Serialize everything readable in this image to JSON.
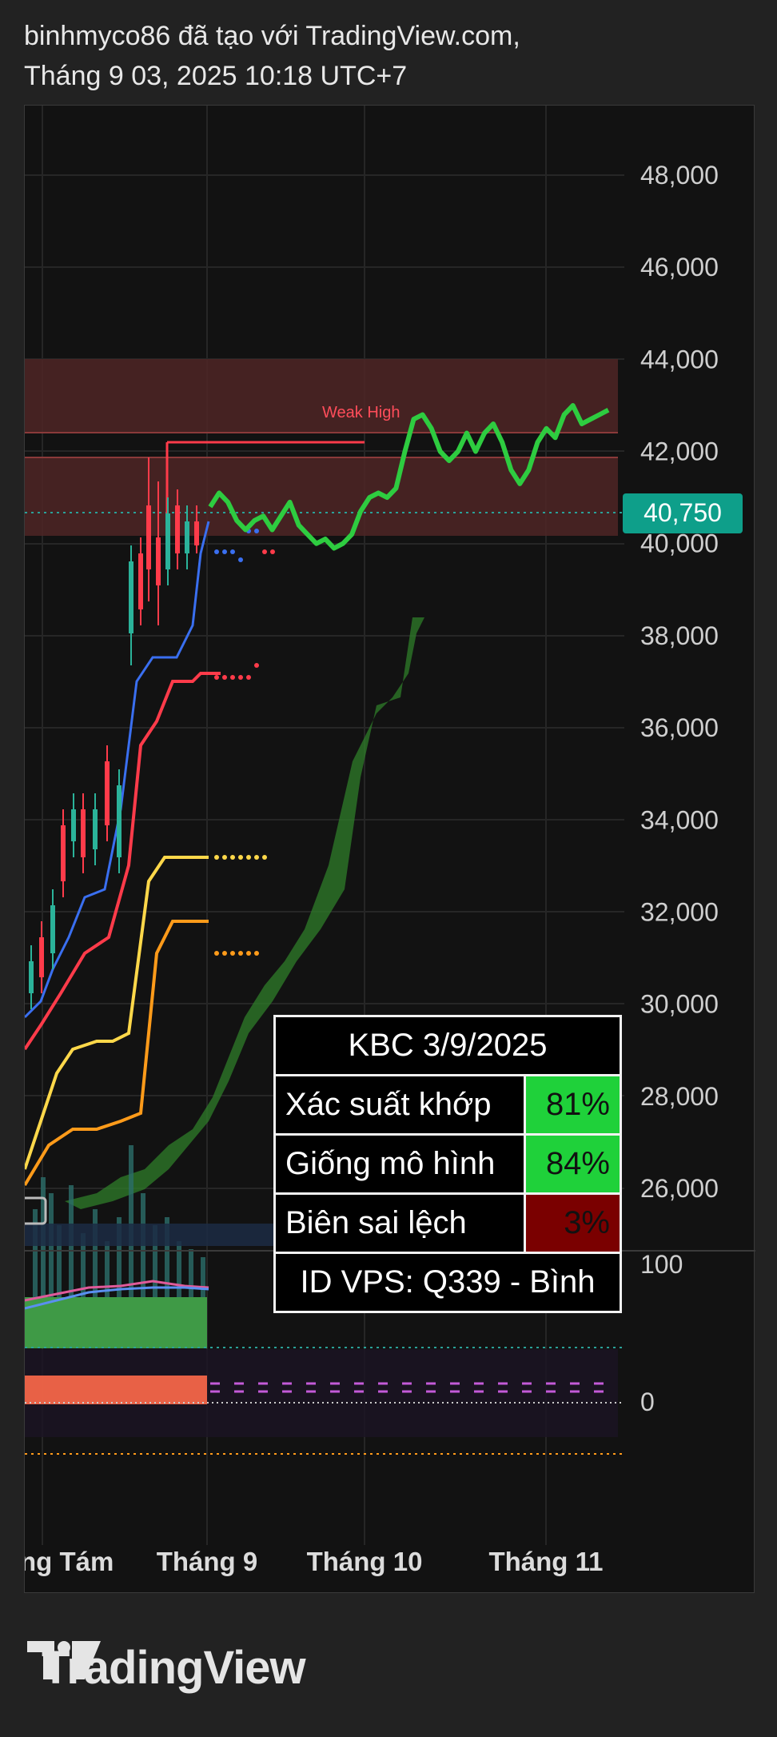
{
  "header": {
    "line1": "binhmyco86 đã tạo với TradingView.com,",
    "line2": "Tháng 9 03, 2025 10:18 UTC+7"
  },
  "colors": {
    "background": "#121212",
    "price_line": "#2ecc40",
    "resistance_zone": "#5a2a2a",
    "current_price_badge": "#0e9f8a",
    "cloud": "#2f7d2a",
    "table_green": "#1fd13a",
    "table_red": "#7a0000"
  },
  "chart_data": {
    "type": "line",
    "symbol": "KBC",
    "current_price": 40750,
    "current_price_label": "40,750",
    "annotation": "Weak High",
    "y_ticks": [
      "48,000",
      "46,000",
      "44,000",
      "42,000",
      "40,000",
      "38,000",
      "36,000",
      "34,000",
      "32,000",
      "30,000",
      "28,000",
      "26,000"
    ],
    "ylim": [
      24500,
      49500
    ],
    "x_ticks": [
      "ng Tám",
      "Tháng 9",
      "Tháng 10",
      "Tháng 11"
    ],
    "resistance_zones": [
      [
        42400,
        44000
      ],
      [
        40200,
        41800
      ]
    ],
    "projection_series": {
      "name": "",
      "color": "#2ecc40",
      "values": [
        40800,
        41100,
        40900,
        40500,
        40300,
        40500,
        40600,
        40300,
        40600,
        40900,
        40400,
        40200,
        40000,
        40100,
        39900,
        40000,
        40200,
        40700,
        41000,
        41100,
        41000,
        41200,
        42000,
        42700,
        42800,
        42500,
        42000,
        41800,
        42000,
        42400,
        42000,
        42400,
        42600,
        42200,
        41600,
        41300,
        41600,
        42200,
        42500,
        42300,
        42800,
        43000,
        42600,
        42700,
        42800,
        42900
      ]
    },
    "oscillator": {
      "y_ticks": [
        "100",
        "0"
      ]
    }
  },
  "stats_table": {
    "title": "KBC 3/9/2025",
    "rows": [
      {
        "label": "Xác suất khớp",
        "value": "81%",
        "color": "#1fd13a"
      },
      {
        "label": "Giống mô hình",
        "value": "84%",
        "color": "#1fd13a"
      },
      {
        "label": "Biên sai lệch",
        "value": "3%",
        "color": "#7a0000"
      }
    ],
    "footer": "ID VPS: Q339 - Bình"
  },
  "footer": {
    "logo_text": "TradingView"
  }
}
